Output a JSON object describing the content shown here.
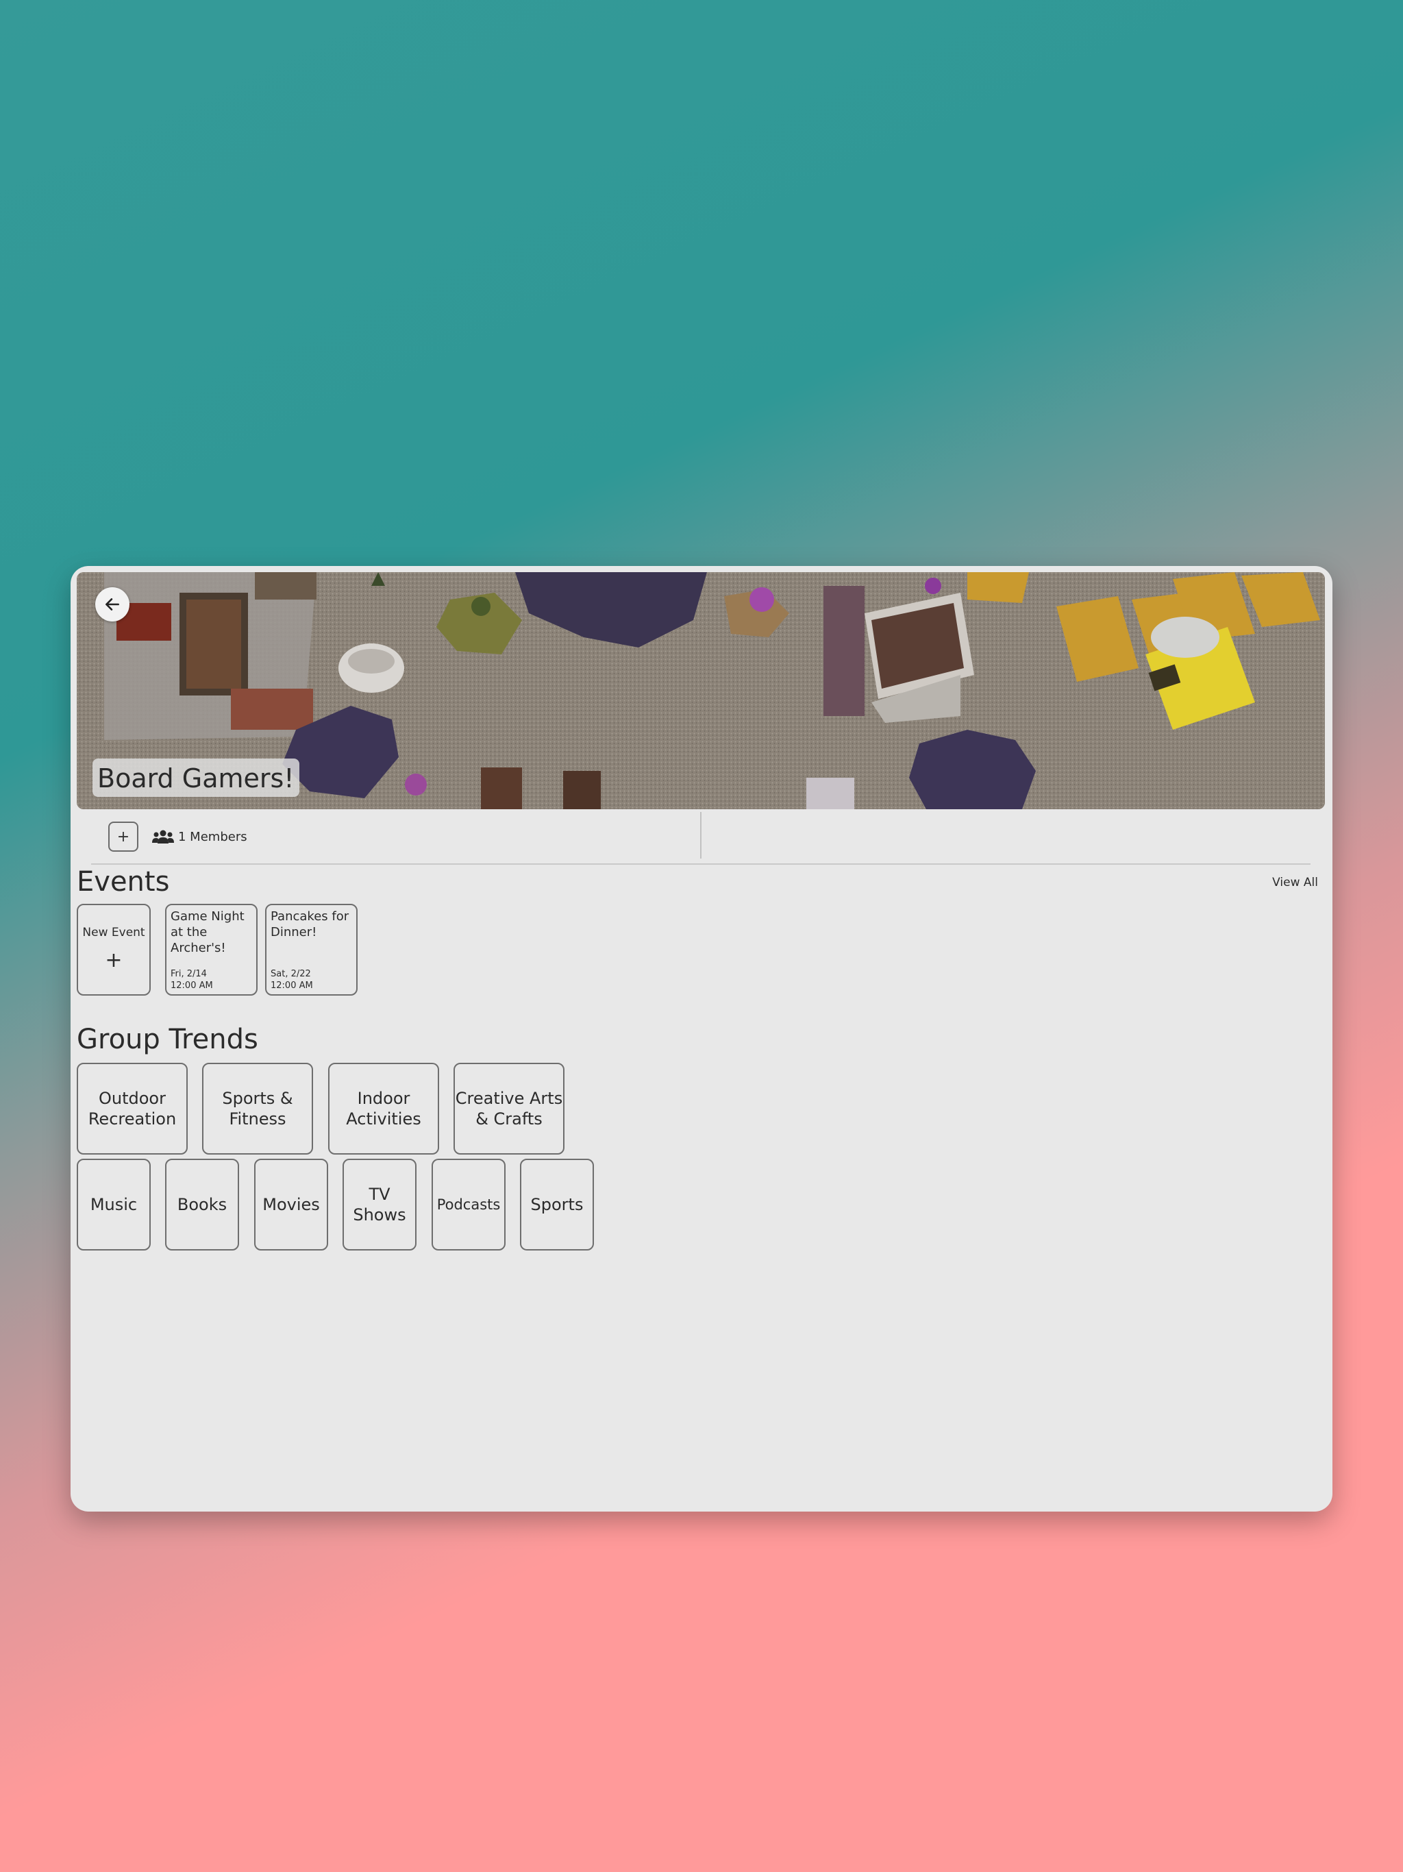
{
  "group": {
    "name": "Board Gamers!",
    "members_label": "1 Members"
  },
  "info_bar": {
    "add_label": "+"
  },
  "events": {
    "title": "Events",
    "view_all": "View All",
    "new_event": {
      "label": "New Event",
      "plus": "+"
    },
    "items": [
      {
        "title": "Game Night at the Archer's!",
        "date": "Fri, 2/14",
        "time": "12:00 AM"
      },
      {
        "title": "Pancakes for Dinner!",
        "date": "Sat, 2/22",
        "time": "12:00 AM"
      }
    ]
  },
  "trends": {
    "title": "Group Trends",
    "row1": [
      "Outdoor Recreation",
      "Sports & Fitness",
      "Indoor Activities",
      "Creative Arts & Crafts"
    ],
    "row2": [
      "Music",
      "Books",
      "Movies",
      "TV Shows",
      "Podcasts",
      "Sports"
    ]
  },
  "icons": {
    "back": "arrow-left-icon",
    "members": "people-icon"
  },
  "colors": {
    "background_top": "#2f9896",
    "background_bottom": "#ff9a9a",
    "panel": "#e8e8e8",
    "card_border": "#6e6e6e"
  }
}
